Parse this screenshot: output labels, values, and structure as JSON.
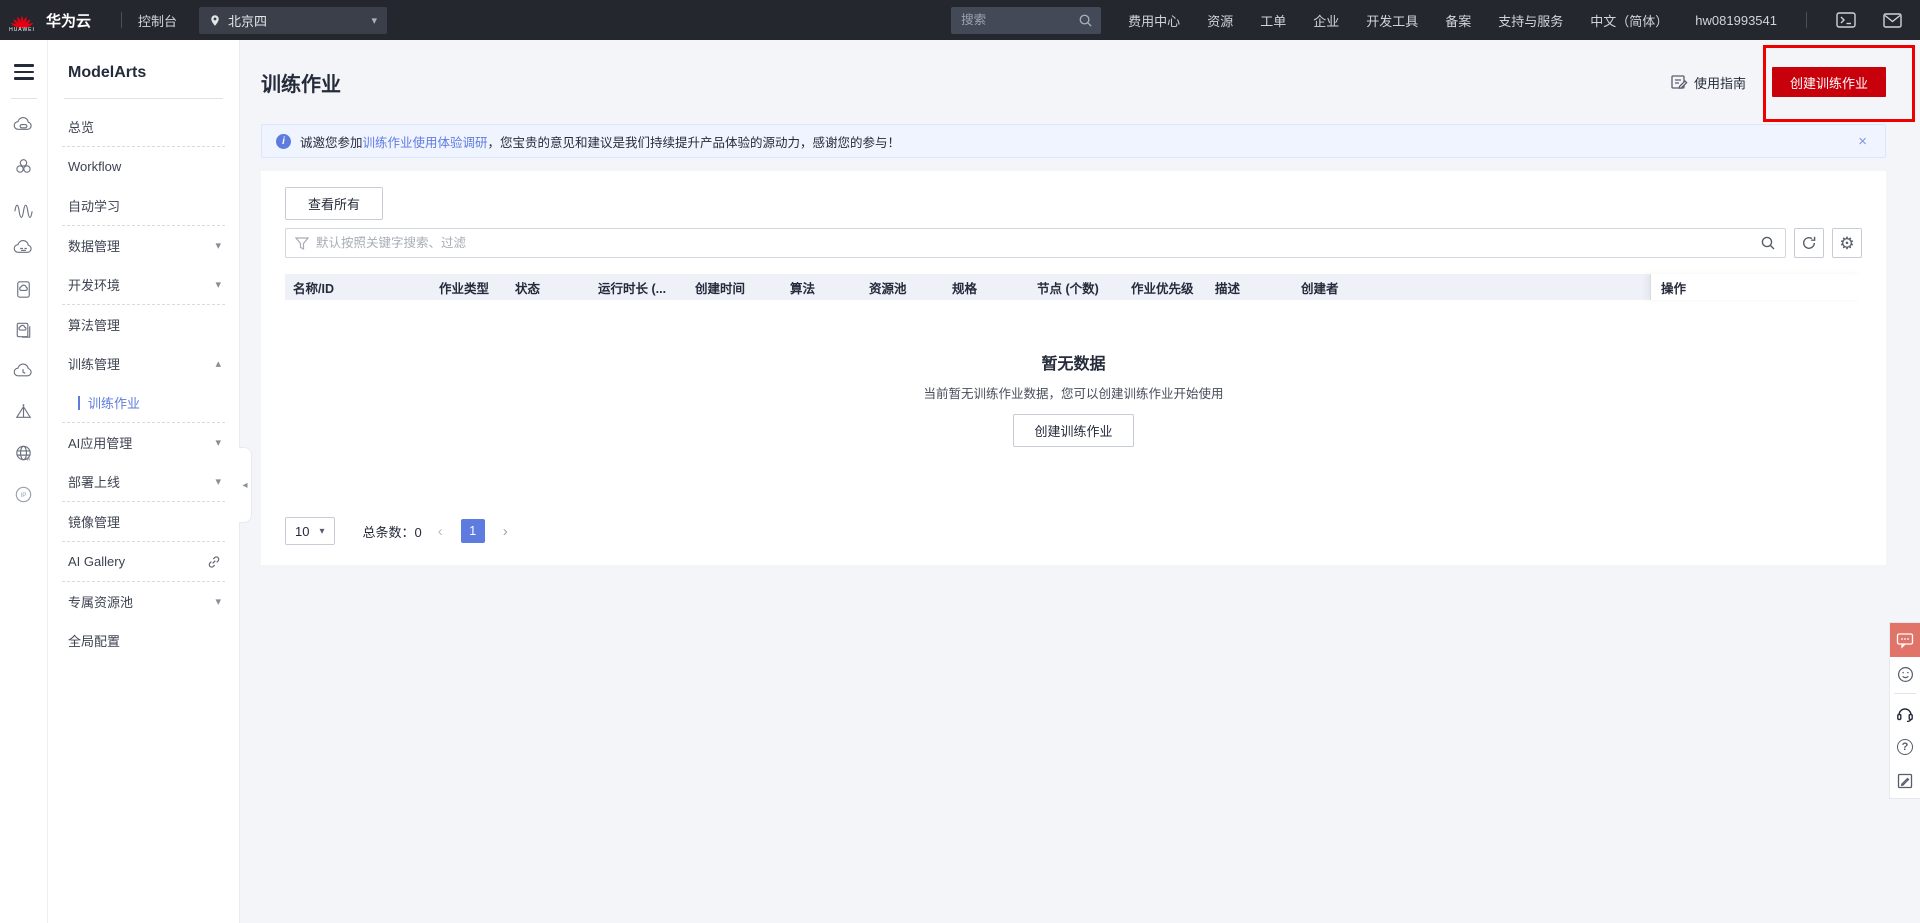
{
  "topbar": {
    "brand": "华为云",
    "brand_logo_word": "HUAWEI",
    "console": "控制台",
    "region": "北京四",
    "search_placeholder": "搜索",
    "menu": [
      "费用中心",
      "资源",
      "工单",
      "企业",
      "开发工具",
      "备案",
      "支持与服务"
    ],
    "language": "中文（简体）",
    "username": "hw081993541"
  },
  "sidebar": {
    "title": "ModelArts",
    "items": [
      {
        "label": "总览"
      },
      {
        "label": "Workflow"
      },
      {
        "label": "自动学习"
      },
      {
        "label": "数据管理"
      },
      {
        "label": "开发环境"
      },
      {
        "label": "算法管理"
      },
      {
        "label": "训练管理"
      },
      {
        "label": "训练作业"
      },
      {
        "label": "AI应用管理"
      },
      {
        "label": "部署上线"
      },
      {
        "label": "镜像管理"
      },
      {
        "label": "AI Gallery"
      },
      {
        "label": "专属资源池"
      },
      {
        "label": "全局配置"
      }
    ]
  },
  "page": {
    "title": "训练作业",
    "guide_label": "使用指南",
    "create_button": "创建训练作业"
  },
  "banner": {
    "text_before": "诚邀您参加",
    "link": "训练作业使用体验调研",
    "text_after": "，您宝贵的意见和建议是我们持续提升产品体验的源动力，感谢您的参与！"
  },
  "filters": {
    "view_all": "查看所有",
    "filter_placeholder": "默认按照关键字搜索、过滤"
  },
  "table": {
    "headers": [
      "名称/ID",
      "作业类型",
      "状态",
      "运行时长 (...",
      "创建时间",
      "算法",
      "资源池",
      "规格",
      "节点 (个数)",
      "作业优先级",
      "描述",
      "创建者",
      "操作"
    ]
  },
  "empty": {
    "title": "暂无数据",
    "description": "当前暂无训练作业数据，您可以创建训练作业开始使用",
    "button": "创建训练作业"
  },
  "pagination": {
    "page_size": "10",
    "total_label": "总条数：",
    "total": "0",
    "current_page": "1"
  },
  "icons": {
    "chevron_down": "▾",
    "chevron_up": "▴",
    "collapse_left": "◂",
    "close": "×",
    "prev": "‹",
    "next": "›",
    "gear": "⚙",
    "info": "i",
    "help": "?"
  },
  "colors": {
    "topbar_bg": "#24272e",
    "page_bg": "#f4f5f9",
    "accent": "#5e7ce0",
    "brand_red": "#c7000b",
    "annotation_red": "#ee0000",
    "banner_bg": "#f0f4ff",
    "thead_bg": "#eef1f8",
    "text_dark": "#252b3a",
    "text_mid": "#575d6c"
  }
}
